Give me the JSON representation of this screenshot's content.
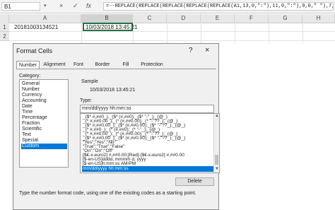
{
  "formula_bar": {
    "name_box": "B1",
    "cancel_icon": "×",
    "enter_icon": "✓",
    "fx_label": "fx",
    "formula": "=--REPLACE(REPLACE(REPLACE(REPLACE(REPLACE(A1,13,0,\":\"),11,0,\":\"),9,0,\" \"),7,0,\"/\"),5,0,\"/\")"
  },
  "columns": [
    "A",
    "B",
    "C",
    "D",
    "E",
    "F",
    "G",
    "H"
  ],
  "rows": [
    "1",
    "2"
  ],
  "cells": {
    "a1": "20181003134521",
    "b1": "10/03/2018 13:45:21"
  },
  "dialog": {
    "title": "Format Cells",
    "help": "?",
    "close": "×",
    "tabs": [
      "Number",
      "Alignment",
      "Font",
      "Border",
      "Fill",
      "Protection"
    ],
    "category_label": "Category:",
    "categories": [
      "General",
      "Number",
      "Currency",
      "Accounting",
      "Date",
      "Time",
      "Percentage",
      "Fraction",
      "Scientific",
      "Text",
      "Special",
      "Custom"
    ],
    "selected_category": "Custom",
    "sample_label": "Sample",
    "sample_value": "10/03/2018 13:45:21",
    "type_label": "Type:",
    "type_value": "mm/dd/yyyy hh:mm:ss",
    "formats": [
      "_($* #,##0_);_($* (#,##0);_($* \"-\"_);_(@_)",
      "_(* #,##0.00_);_(* (#,##0.00);_(* \"-\"??_);_(@_)",
      "_($* #,##0.00_);_($* (#,##0.00);_($* \"-\"??_);_(@_)",
      "_(* #,##0_);_(* (#,##0);_(* \"-\"_);_(@_)",
      "_(* #,##0.00_);_(* (#,##0.00);_(* \"-\"??_);_(@_)",
      "_($* #,##0.00_);_($* (#,##0.00);_($* \"-\"??_);_(@_)",
      "\"Yes\";\"Yes\";\"No\"",
      "\"True\";\"True\";\"False\"",
      "\"On\";\"On\";\"Off\"",
      "[$€-x-euro2] #,##0.00;[Red]-[$€-x-euro2] #,##0.00",
      "[$-en-US]dddd, mmmm d, yyyy",
      "[$-en-US]h:mm:ss AM/PM",
      "mm/dd/yyyy hh:mm:ss"
    ],
    "selected_format": "mm/dd/yyyy hh:mm:ss",
    "delete_label": "Delete",
    "hint": "Type the number format code, using one of the existing codes as a starting point."
  },
  "colors": {
    "selection": "#0078d7",
    "active_cell_border": "#217346"
  }
}
